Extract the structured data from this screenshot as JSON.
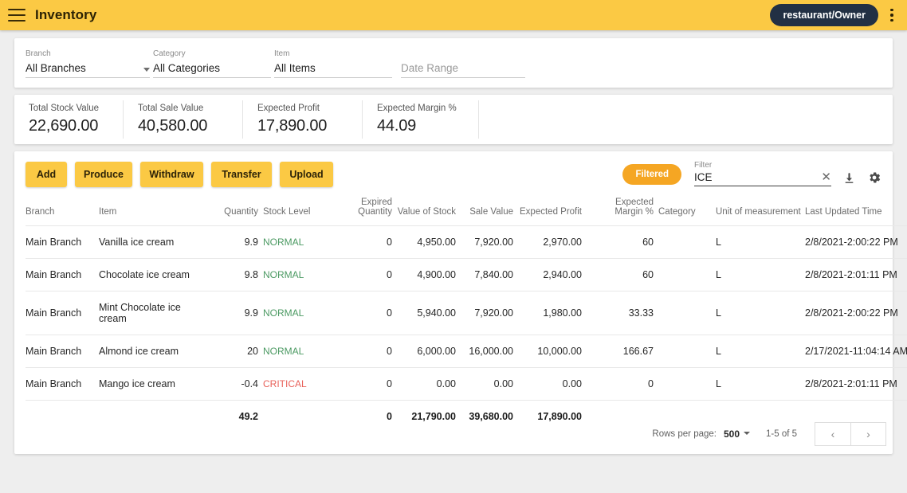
{
  "appbar": {
    "menu_icon": "hamburger-menu-icon",
    "title": "Inventory",
    "user_chip": "restaurant/Owner",
    "overflow_icon": "more-vertical-icon",
    "bg_color": "#fbc944"
  },
  "filters": {
    "branch": {
      "label": "Branch",
      "value": "All Branches"
    },
    "category": {
      "label": "Category",
      "value": "All Categories"
    },
    "item": {
      "label": "Item",
      "value": "All Items"
    },
    "date_range": {
      "label": "",
      "placeholder": "Date Range",
      "value": "Date Range"
    }
  },
  "stats": [
    {
      "label": "Total Stock Value",
      "value": "22,690.00"
    },
    {
      "label": "Total Sale Value",
      "value": "40,580.00"
    },
    {
      "label": "Expected Profit",
      "value": "17,890.00"
    },
    {
      "label": "Expected Margin %",
      "value": "44.09"
    }
  ],
  "toolbar": {
    "add_label": "Add",
    "produce_label": "Produce",
    "withdraw_label": "Withdraw",
    "transfer_label": "Transfer",
    "upload_label": "Upload",
    "filtered_badge": "Filtered",
    "filter_label": "Filter",
    "filter_value": "ICE",
    "clear_icon": "✕",
    "download_icon": "download-icon",
    "settings_icon": "gear-icon",
    "badge_color": "#f5a623",
    "button_color": "#fbc944"
  },
  "table": {
    "columns": [
      "Branch",
      "Item",
      "Quantity",
      "Stock Level",
      "Expired Quantity",
      "Value of Stock",
      "Sale Value",
      "Expected Profit",
      "Expected Margin %",
      "Category",
      "Unit of measurement",
      "Last Updated Time"
    ],
    "rows": [
      {
        "branch": "Main Branch",
        "item": "Vanilla ice cream",
        "quantity": "9.9",
        "stock_level": "NORMAL",
        "expired_quantity": "0",
        "value_of_stock": "4,950.00",
        "sale_value": "7,920.00",
        "expected_profit": "2,970.00",
        "expected_margin": "60",
        "category": "",
        "uom": "L",
        "last_updated": "2/8/2021-2:00:22 PM"
      },
      {
        "branch": "Main Branch",
        "item": "Chocolate ice cream",
        "quantity": "9.8",
        "stock_level": "NORMAL",
        "expired_quantity": "0",
        "value_of_stock": "4,900.00",
        "sale_value": "7,840.00",
        "expected_profit": "2,940.00",
        "expected_margin": "60",
        "category": "",
        "uom": "L",
        "last_updated": "2/8/2021-2:01:11 PM"
      },
      {
        "branch": "Main Branch",
        "item": "Mint Chocolate ice cream",
        "quantity": "9.9",
        "stock_level": "NORMAL",
        "expired_quantity": "0",
        "value_of_stock": "5,940.00",
        "sale_value": "7,920.00",
        "expected_profit": "1,980.00",
        "expected_margin": "33.33",
        "category": "",
        "uom": "L",
        "last_updated": "2/8/2021-2:00:22 PM"
      },
      {
        "branch": "Main Branch",
        "item": "Almond ice cream",
        "quantity": "20",
        "stock_level": "NORMAL",
        "expired_quantity": "0",
        "value_of_stock": "6,000.00",
        "sale_value": "16,000.00",
        "expected_profit": "10,000.00",
        "expected_margin": "166.67",
        "category": "",
        "uom": "L",
        "last_updated": "2/17/2021-11:04:14 AM"
      },
      {
        "branch": "Main Branch",
        "item": "Mango ice cream",
        "quantity": "-0.4",
        "stock_level": "CRITICAL",
        "expired_quantity": "0",
        "value_of_stock": "0.00",
        "sale_value": "0.00",
        "expected_profit": "0.00",
        "expected_margin": "0",
        "category": "",
        "uom": "L",
        "last_updated": "2/8/2021-2:01:11 PM"
      }
    ],
    "totals": {
      "branch": "",
      "item": "",
      "quantity": "49.2",
      "stock_level": "",
      "expired_quantity": "0",
      "value_of_stock": "21,790.00",
      "sale_value": "39,680.00",
      "expected_profit": "17,890.00",
      "expected_margin": "",
      "category": "",
      "uom": "",
      "last_updated": ""
    },
    "level_colors": {
      "NORMAL": "#4c9a63",
      "CRITICAL": "#e8615a"
    }
  },
  "paginator": {
    "rows_per_page_label": "Rows per page:",
    "rows_per_page_value": "500",
    "range_label": "1-5 of 5",
    "prev_icon": "‹",
    "next_icon": "›"
  }
}
